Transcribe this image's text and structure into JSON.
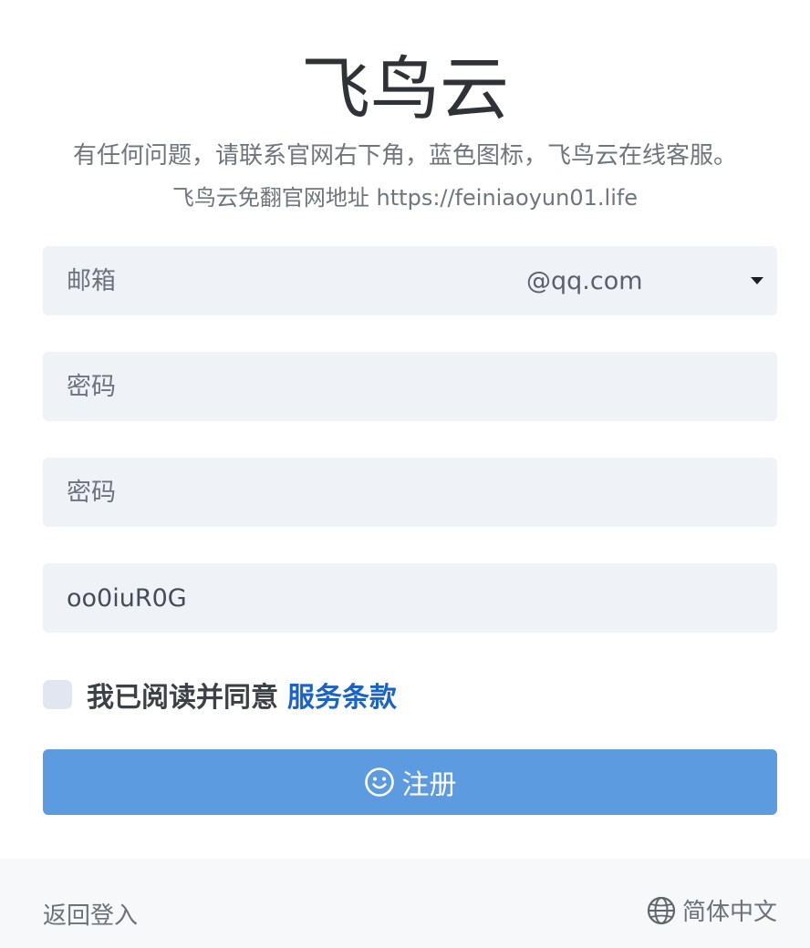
{
  "brand": {
    "title": "飞鸟云",
    "subtitle": "有任何问题，请联系官网右下角，蓝色图标，飞鸟云在线客服。",
    "url_line": "飞鸟云免翻官网地址 https://feiniaoyun01.life"
  },
  "form": {
    "email": {
      "placeholder": "邮箱",
      "value": "",
      "suffix": "@qq.com"
    },
    "password": {
      "placeholder": "密码",
      "value": ""
    },
    "password_confirm": {
      "placeholder": "密码",
      "value": ""
    },
    "invite_code": {
      "placeholder": "",
      "value": "oo0iuR0G"
    },
    "agree_label": "我已阅读并同意",
    "terms_link": "服务条款",
    "agree_checked": false,
    "register_label": "注册"
  },
  "footer": {
    "back_login": "返回登入",
    "language": "简体中文"
  },
  "colors": {
    "accent_button": "#5d9be0",
    "link": "#1b63c9",
    "field_bg": "#eff2f7",
    "footer_bg": "#f7f8fa"
  },
  "icons": {
    "register": "smile-icon",
    "language": "globe-icon",
    "dropdown": "caret-down-icon"
  }
}
